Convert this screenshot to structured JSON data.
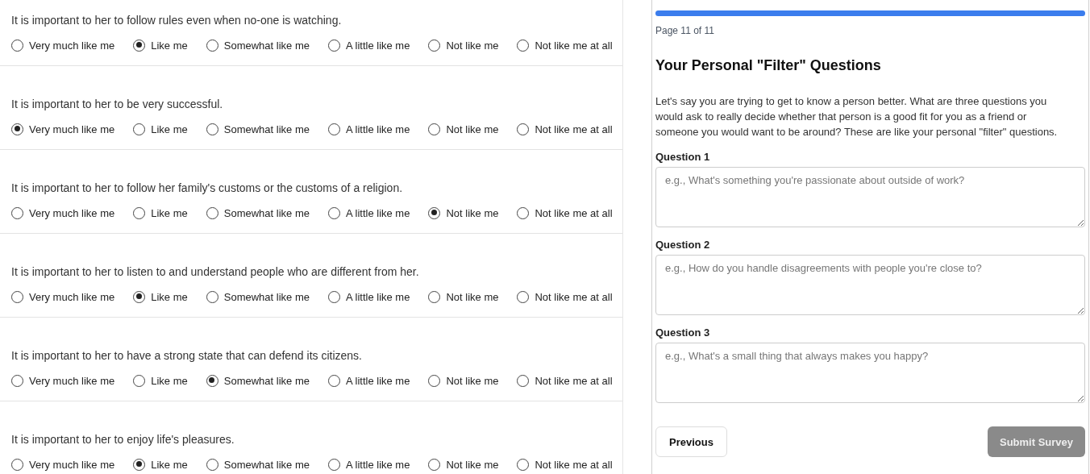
{
  "questions": [
    {
      "text": "It is important to her to follow rules even when no-one is watching.",
      "options": [
        {
          "label": "Very much like me",
          "selected": false
        },
        {
          "label": "Like me",
          "selected": true
        },
        {
          "label": "Somewhat like me",
          "selected": false
        },
        {
          "label": "A little like me",
          "selected": false
        },
        {
          "label": "Not like me",
          "selected": false
        },
        {
          "label": "Not like me at all",
          "selected": false
        }
      ]
    },
    {
      "text": "It is important to her to be very successful.",
      "options": [
        {
          "label": "Very much like me",
          "selected": true
        },
        {
          "label": "Like me",
          "selected": false
        },
        {
          "label": "Somewhat like me",
          "selected": false
        },
        {
          "label": "A little like me",
          "selected": false
        },
        {
          "label": "Not like me",
          "selected": false
        },
        {
          "label": "Not like me at all",
          "selected": false
        }
      ]
    },
    {
      "text": "It is important to her to follow her family's customs or the customs of a religion.",
      "options": [
        {
          "label": "Very much like me",
          "selected": false
        },
        {
          "label": "Like me",
          "selected": false
        },
        {
          "label": "Somewhat like me",
          "selected": false
        },
        {
          "label": "A little like me",
          "selected": false
        },
        {
          "label": "Not like me",
          "selected": true
        },
        {
          "label": "Not like me at all",
          "selected": false
        }
      ]
    },
    {
      "text": "It is important to her to listen to and understand people who are different from her.",
      "options": [
        {
          "label": "Very much like me",
          "selected": false
        },
        {
          "label": "Like me",
          "selected": true
        },
        {
          "label": "Somewhat like me",
          "selected": false
        },
        {
          "label": "A little like me",
          "selected": false
        },
        {
          "label": "Not like me",
          "selected": false
        },
        {
          "label": "Not like me at all",
          "selected": false
        }
      ]
    },
    {
      "text": "It is important to her to have a strong state that can defend its citizens.",
      "options": [
        {
          "label": "Very much like me",
          "selected": false
        },
        {
          "label": "Like me",
          "selected": false
        },
        {
          "label": "Somewhat like me",
          "selected": true
        },
        {
          "label": "A little like me",
          "selected": false
        },
        {
          "label": "Not like me",
          "selected": false
        },
        {
          "label": "Not like me at all",
          "selected": false
        }
      ]
    },
    {
      "text": "It is important to her to enjoy life's pleasures.",
      "options": [
        {
          "label": "Very much like me",
          "selected": false
        },
        {
          "label": "Like me",
          "selected": true
        },
        {
          "label": "Somewhat like me",
          "selected": false
        },
        {
          "label": "A little like me",
          "selected": false
        },
        {
          "label": "Not like me",
          "selected": false
        },
        {
          "label": "Not like me at all",
          "selected": false
        }
      ]
    }
  ],
  "panel": {
    "progress": {
      "level": 1
    },
    "page": "Page 11 of 11",
    "title": "Your Personal \"Filter\" Questions",
    "intro": "Let's say you are trying to get to know a person better. What are three questions you would ask to really decide whether that person is a good fit for you as a friend or someone you would want to be around? These are like your personal \"filter\" questions.",
    "fields": [
      {
        "label": "Question 1",
        "placeholder": "e.g., What's something you're passionate about outside of work?"
      },
      {
        "label": "Question 2",
        "placeholder": "e.g., How do you handle disagreements with people you're close to?"
      },
      {
        "label": "Question 3",
        "placeholder": "e.g., What's a small thing that always makes you happy?"
      }
    ],
    "previous": "Previous",
    "submit": {
      "label": "Submit Survey",
      "disabled": true
    }
  }
}
